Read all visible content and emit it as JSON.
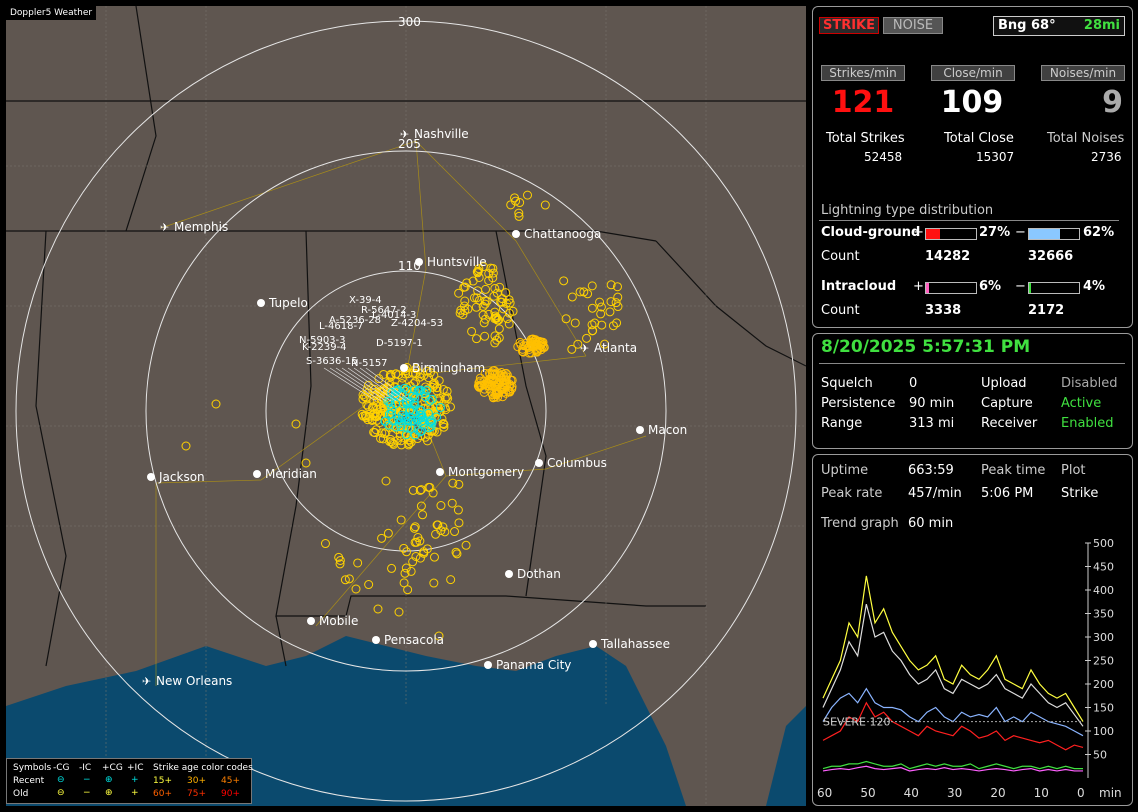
{
  "app_title": "Doppler5 Weather",
  "map": {
    "range_labels": [
      "300",
      "205",
      "110"
    ],
    "cities": [
      {
        "name": "Nashville",
        "icon": "airport"
      },
      {
        "name": "Memphis",
        "icon": "airport"
      },
      {
        "name": "Chattanooga",
        "icon": "dot"
      },
      {
        "name": "Huntsville",
        "icon": "dot"
      },
      {
        "name": "Tupelo",
        "icon": "dot"
      },
      {
        "name": "Atlanta",
        "icon": "airport"
      },
      {
        "name": "Birmingham",
        "icon": "dot"
      },
      {
        "name": "Macon",
        "icon": "dot"
      },
      {
        "name": "Jackson",
        "icon": "dot"
      },
      {
        "name": "Meridian",
        "icon": "dot"
      },
      {
        "name": "Montgomery",
        "icon": "dot"
      },
      {
        "name": "Columbus",
        "icon": "dot"
      },
      {
        "name": "Dothan",
        "icon": "dot"
      },
      {
        "name": "Mobile",
        "icon": "dot"
      },
      {
        "name": "Pensacola",
        "icon": "dot"
      },
      {
        "name": "Tallahassee",
        "icon": "dot"
      },
      {
        "name": "Panama City",
        "icon": "dot"
      },
      {
        "name": "New Orleans",
        "icon": "airport"
      }
    ],
    "cell_labels": [
      "X-39-4",
      "R-5647-2",
      "A-5236-28",
      "L-4014-3",
      "L-4618-7",
      "Z-4204-53",
      "N-5903-3",
      "D-5197-1",
      "K-2239-4",
      "S-3636-15",
      "N-5157"
    ],
    "colors": {
      "land": "#5f5650",
      "water": "#0b4a6e",
      "cg": "#ffd200",
      "ic": "#00e0e0",
      "range_ring": "#e6e6e6"
    }
  },
  "legend": {
    "symbols_label": "Symbols",
    "cols": [
      "-CG",
      "-IC",
      "+CG",
      "+IC"
    ],
    "age_label": "Strike age color codes",
    "recent_label": "Recent",
    "old_label": "Old",
    "recent_ages": [
      "15+",
      "30+",
      "45+"
    ],
    "old_ages": [
      "60+",
      "75+",
      "90+"
    ]
  },
  "strike_panel": {
    "strike_btn": "STRIKE",
    "noise_btn": "NOISE",
    "bearing": "Bng 68°",
    "distance": "28mi",
    "rate_headers": [
      "Strikes/min",
      "Close/min",
      "Noises/min"
    ],
    "rates": [
      "121",
      "109",
      "9"
    ],
    "totals_labels": [
      "Total Strikes",
      "Total Close",
      "Total Noises"
    ],
    "totals": [
      "52458",
      "15307",
      "2736"
    ],
    "dist_title": "Lightning type distribution",
    "cloud_ground_label": "Cloud-ground",
    "cg_pos_sign": "+",
    "cg_pos_pct": "27%",
    "cg_pos_frac": 0.27,
    "cg_neg_sign": "−",
    "cg_neg_pct": "62%",
    "cg_neg_frac": 0.62,
    "count_label": "Count",
    "cg_pos_count": "14282",
    "cg_neg_count": "32666",
    "intracloud_label": "Intracloud",
    "ic_pos_sign": "+",
    "ic_pos_pct": "6%",
    "ic_pos_frac": 0.06,
    "ic_neg_sign": "−",
    "ic_neg_pct": "4%",
    "ic_neg_frac": 0.04,
    "ic_pos_count": "3338",
    "ic_neg_count": "2172"
  },
  "status_panel": {
    "datetime": "8/20/2025 5:57:31 PM",
    "squelch_label": "Squelch",
    "squelch": "0",
    "upload_label": "Upload",
    "upload": "Disabled",
    "persistence_label": "Persistence",
    "persistence": "90 min",
    "capture_label": "Capture",
    "capture": "Active",
    "range_label": "Range",
    "range": "313 mi",
    "receiver_label": "Receiver",
    "receiver": "Enabled"
  },
  "trend_panel": {
    "uptime_label": "Uptime",
    "uptime": "663:59",
    "peak_time_label": "Peak time",
    "plot_label": "Plot",
    "peak_rate_label": "Peak rate",
    "peak_rate": "457/min",
    "peak_time": "5:06 PM",
    "plot": "Strike",
    "trend_label": "Trend graph",
    "trend": "60 min",
    "severe_label": "SEVERE 120",
    "x_ticks": [
      "60",
      "50",
      "40",
      "30",
      "20",
      "10",
      "0"
    ],
    "x_unit": "min",
    "y_ticks": [
      "500",
      "450",
      "400",
      "350",
      "300",
      "250",
      "200",
      "150",
      "100",
      "50"
    ]
  },
  "chart_data": {
    "type": "line",
    "x": [
      60,
      58,
      56,
      54,
      52,
      50,
      48,
      46,
      44,
      42,
      40,
      38,
      36,
      34,
      32,
      30,
      28,
      26,
      24,
      22,
      20,
      18,
      16,
      14,
      12,
      10,
      8,
      6,
      4,
      2,
      0
    ],
    "xlim": [
      60,
      0
    ],
    "ylim": [
      0,
      500
    ],
    "series": [
      {
        "color": "#ffff40",
        "values": [
          170,
          210,
          250,
          330,
          300,
          430,
          330,
          360,
          310,
          280,
          250,
          230,
          240,
          260,
          210,
          200,
          240,
          220,
          210,
          230,
          260,
          210,
          200,
          190,
          230,
          200,
          180,
          170,
          180,
          150,
          120
        ]
      },
      {
        "color": "#dddddd",
        "values": [
          150,
          190,
          230,
          290,
          260,
          370,
          300,
          310,
          270,
          250,
          220,
          200,
          210,
          230,
          190,
          180,
          210,
          200,
          190,
          200,
          220,
          190,
          180,
          170,
          200,
          180,
          160,
          150,
          160,
          135,
          110
        ]
      },
      {
        "color": "#8ab4ff",
        "values": [
          120,
          150,
          170,
          180,
          160,
          190,
          160,
          150,
          150,
          145,
          130,
          120,
          140,
          150,
          130,
          120,
          140,
          130,
          135,
          130,
          150,
          120,
          130,
          120,
          140,
          130,
          120,
          115,
          110,
          100,
          90
        ]
      },
      {
        "color": "#ff2020",
        "values": [
          80,
          90,
          100,
          130,
          120,
          160,
          130,
          140,
          120,
          110,
          100,
          90,
          110,
          100,
          95,
          90,
          110,
          100,
          85,
          90,
          100,
          80,
          90,
          85,
          80,
          75,
          80,
          70,
          60,
          70,
          65
        ]
      },
      {
        "color": "#40e040",
        "values": [
          20,
          25,
          25,
          30,
          30,
          35,
          30,
          25,
          25,
          30,
          20,
          25,
          30,
          25,
          30,
          25,
          25,
          30,
          20,
          25,
          30,
          25,
          20,
          25,
          25,
          20,
          25,
          20,
          25,
          20,
          20
        ]
      },
      {
        "color": "#ff60ff",
        "values": [
          15,
          18,
          20,
          18,
          22,
          25,
          20,
          18,
          20,
          22,
          15,
          18,
          20,
          18,
          22,
          18,
          20,
          18,
          15,
          18,
          20,
          18,
          15,
          18,
          20,
          15,
          18,
          15,
          18,
          15,
          15
        ]
      }
    ]
  }
}
